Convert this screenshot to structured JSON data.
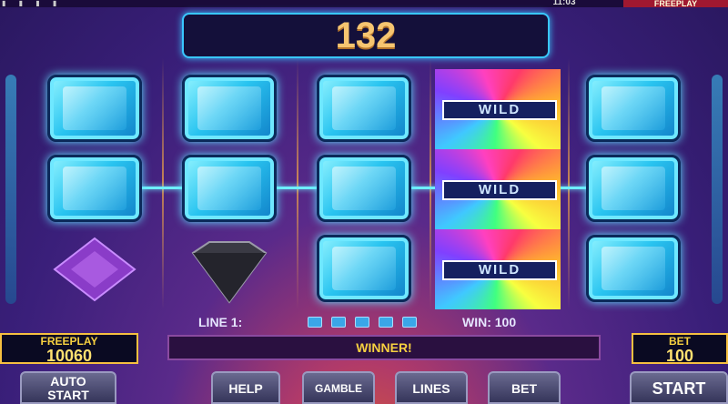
{
  "status_bar": {
    "time": "11:03",
    "mode": "FREEPLAY"
  },
  "win_display": "132",
  "reels": [
    [
      "ice-gem",
      "ice-gem",
      "purple-diamond"
    ],
    [
      "ice-gem",
      "ice-gem",
      "dark-diamond"
    ],
    [
      "ice-gem",
      "ice-gem",
      "ice-gem"
    ],
    [
      "wild",
      "wild",
      "wild"
    ],
    [
      "ice-gem",
      "ice-gem",
      "ice-gem"
    ]
  ],
  "wild_label": "WILD",
  "line_info": {
    "line_label": "LINE 1:",
    "win_label": "WIN: 100"
  },
  "credit": {
    "label": "FREEPLAY",
    "value": "10060"
  },
  "message": "WINNER!",
  "bet": {
    "label": "BET",
    "value": "100"
  },
  "buttons": {
    "auto_start_1": "AUTO",
    "auto_start_2": "START",
    "help": "HELP",
    "gamble": "GAMBLE",
    "lines": "LINES",
    "bet": "BET",
    "start": "START"
  },
  "colors": {
    "accent": "#39c7ff",
    "gold": "#f6c040",
    "win_number": "#f6c570"
  }
}
